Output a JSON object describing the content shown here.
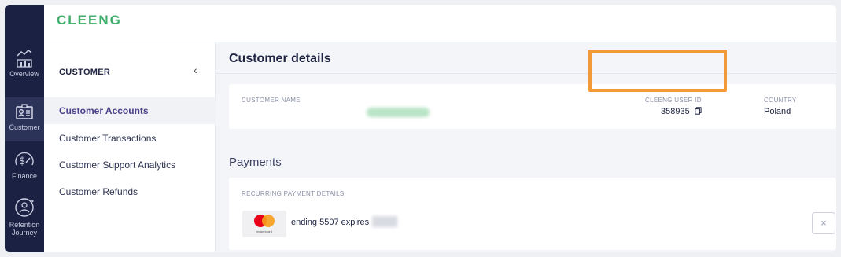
{
  "app": {
    "logo": "CLEENG"
  },
  "rail": {
    "items": [
      {
        "label": "Overview",
        "icon": "chart-icon"
      },
      {
        "label": "Customer",
        "icon": "id-card-icon"
      },
      {
        "label": "Finance",
        "icon": "dollar-gauge-icon"
      },
      {
        "label": "Retention Journey",
        "icon": "retention-icon"
      }
    ]
  },
  "sidebar": {
    "title": "CUSTOMER",
    "collapse_icon": "chevron-left-icon",
    "items": [
      {
        "label": "Customer Accounts",
        "active": true
      },
      {
        "label": "Customer Transactions",
        "active": false
      },
      {
        "label": "Customer Support Analytics",
        "active": false
      },
      {
        "label": "Customer Refunds",
        "active": false
      }
    ]
  },
  "main": {
    "title": "Customer details",
    "details": {
      "name_label": "CUSTOMER NAME",
      "user_id_label": "CLEENG USER ID",
      "user_id_value": "358935",
      "country_label": "COUNTRY",
      "country_value": "Poland"
    },
    "payments": {
      "title": "Payments",
      "recurring_label": "RECURRING PAYMENT DETAILS",
      "card_brand": "mastercard",
      "card_text": "ending 5507 expires"
    }
  },
  "colors": {
    "rail_bg": "#1b2142",
    "brand_green": "#3fae6a",
    "highlight": "#f39a38",
    "active_text": "#4a3f8a"
  }
}
